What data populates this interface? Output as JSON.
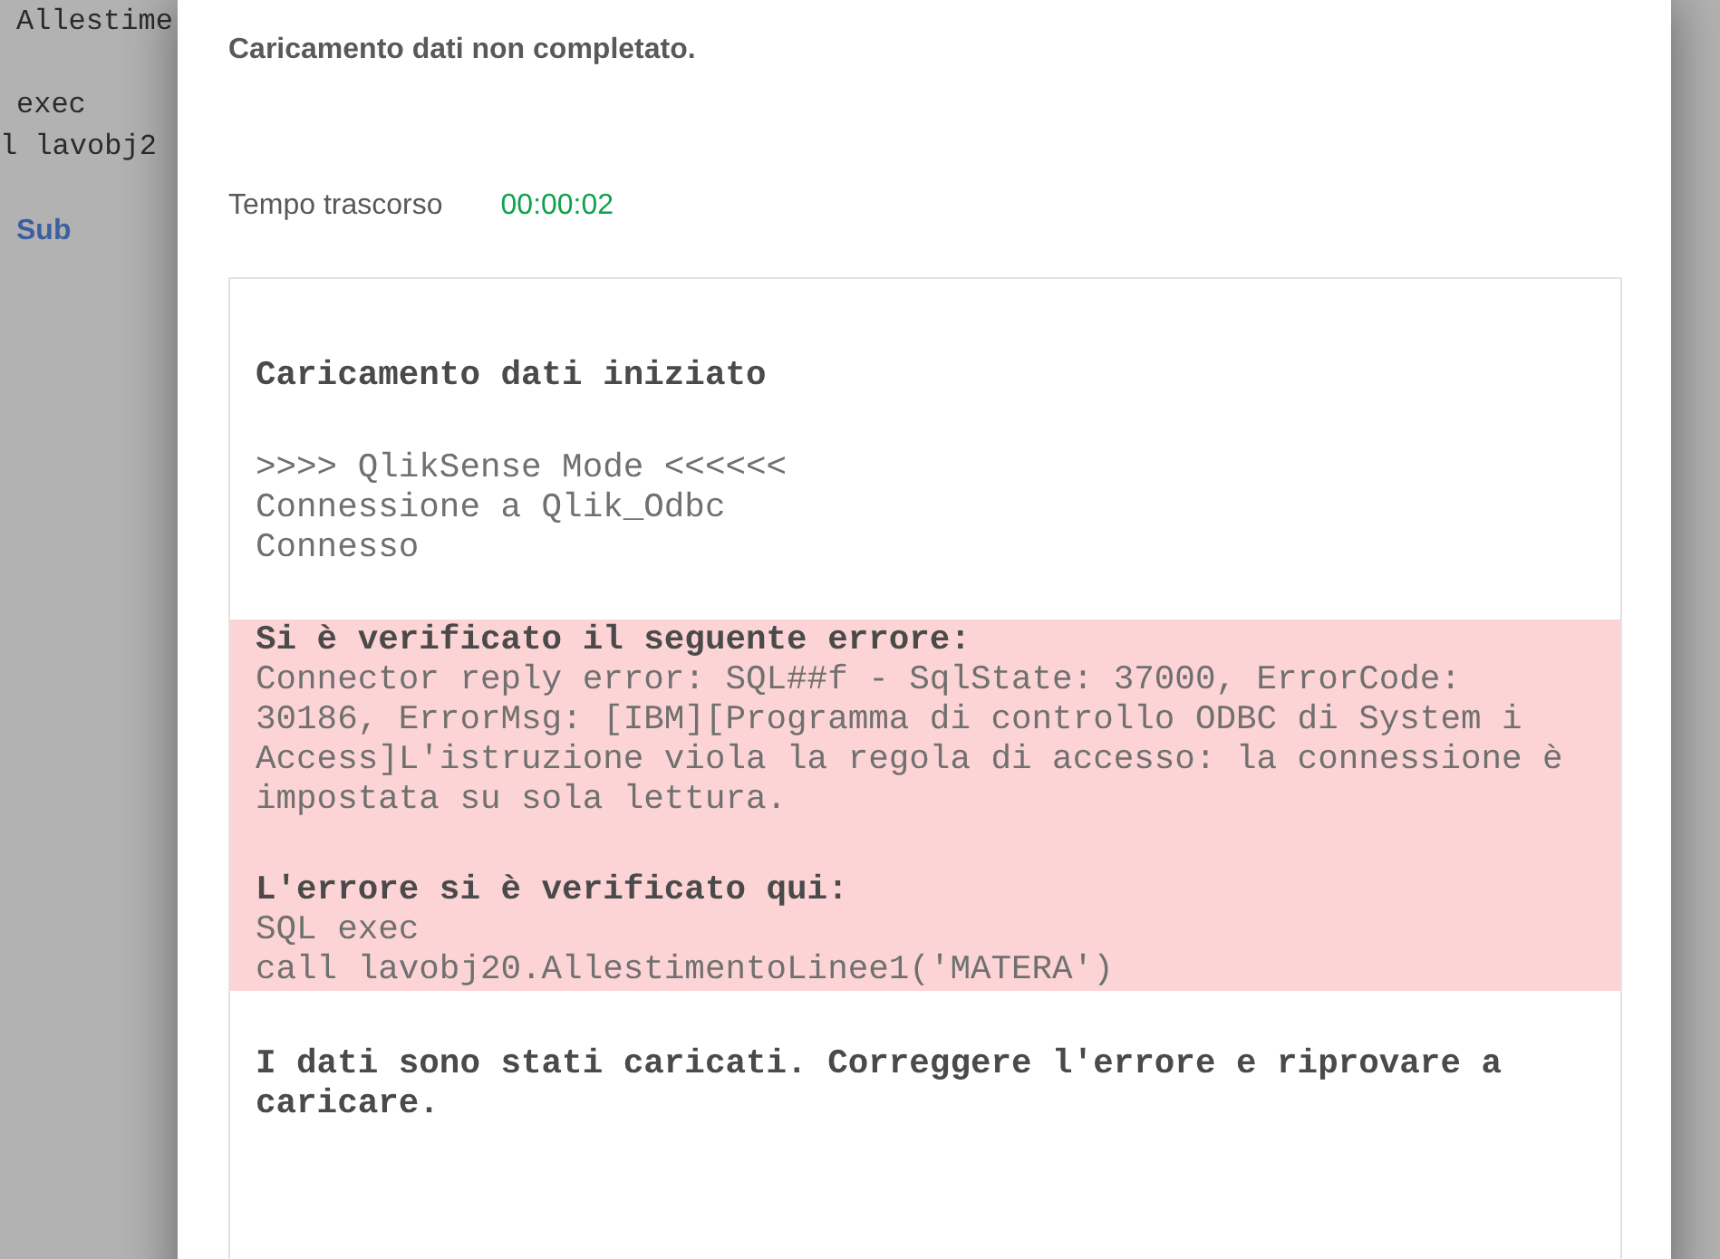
{
  "editor": {
    "blocks": [
      {
        "lines": [
          {
            "text": "Allestime",
            "kind": "code"
          }
        ]
      },
      {
        "lines": [
          {
            "text": "exec",
            "kind": "code"
          },
          {
            "text": "l lavobj2",
            "kind": "code"
          }
        ]
      },
      {
        "lines": [
          {
            "text": "Sub",
            "kind": "keyword"
          }
        ]
      }
    ]
  },
  "dialog": {
    "title": "Caricamento dati non completato.",
    "elapsed": {
      "label": "Tempo trascorso",
      "value": "00:00:02"
    },
    "log": {
      "blocks": [
        {
          "kind": "plain",
          "groups": [
            [
              {
                "kind": "heading",
                "text": "Caricamento dati iniziato"
              }
            ]
          ]
        },
        {
          "kind": "plain",
          "groups": [
            [
              {
                "kind": "text",
                "text": ">>>> QlikSense Mode <<<<<<"
              },
              {
                "kind": "text",
                "text": "Connessione a Qlik_Odbc"
              },
              {
                "kind": "text",
                "text": "Connesso"
              }
            ]
          ]
        },
        {
          "kind": "error",
          "groups": [
            [
              {
                "kind": "heading",
                "text": "Si è verificato il seguente errore:"
              },
              {
                "kind": "text",
                "text": "Connector reply error: SQL##f - SqlState: 37000, ErrorCode: 30186, ErrorMsg: [IBM][Programma di controllo ODBC di System i Access]L'istruzione viola la regola di accesso: la connessione è impostata su sola lettura."
              }
            ],
            [
              {
                "kind": "heading",
                "text": "L'errore si è verificato qui:"
              },
              {
                "kind": "text",
                "text": "SQL exec"
              },
              {
                "kind": "text",
                "text": "call lavobj20.AllestimentoLinee1('MATERA')"
              }
            ]
          ]
        },
        {
          "kind": "plain",
          "groups": [
            [
              {
                "kind": "heading",
                "text": "I dati sono stati caricati. Correggere l'errore e riprovare a caricare."
              }
            ]
          ]
        }
      ]
    }
  }
}
